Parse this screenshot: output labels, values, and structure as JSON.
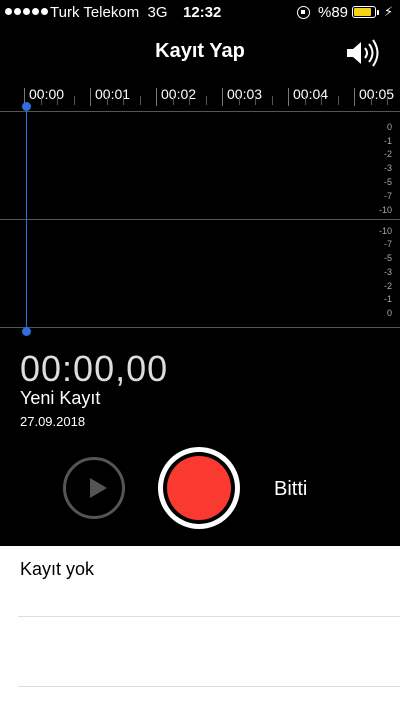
{
  "status_bar": {
    "carrier": "Turk Telekom",
    "network": "3G",
    "time": "12:32",
    "battery_percent": "%89",
    "battery_level": 0.89,
    "battery_color": "#f7d215",
    "orientation_lock_icon": "rotation-lock-icon",
    "charging_icon": "bolt-icon"
  },
  "nav": {
    "title": "Kayıt Yap",
    "speaker_icon": "speaker-icon"
  },
  "timeline": {
    "labels": [
      "00:00",
      "00:01",
      "00:02",
      "00:03",
      "00:04",
      "00:05"
    ]
  },
  "waveform": {
    "upper_db_labels": [
      "0",
      "-1",
      "-2",
      "-3",
      "-5",
      "-7",
      "-10"
    ],
    "lower_db_labels": [
      "-10",
      "-7",
      "-5",
      "-3",
      "-2",
      "-1",
      "0"
    ],
    "playhead_color": "#2f6de0"
  },
  "recording": {
    "counter": "00:00,00",
    "name": "Yeni Kayıt",
    "date": "27.09.2018"
  },
  "controls": {
    "play_icon": "play-icon",
    "record_color": "#fa3a30",
    "done_label": "Bitti"
  },
  "list": {
    "empty_label": "Kayıt yok"
  }
}
